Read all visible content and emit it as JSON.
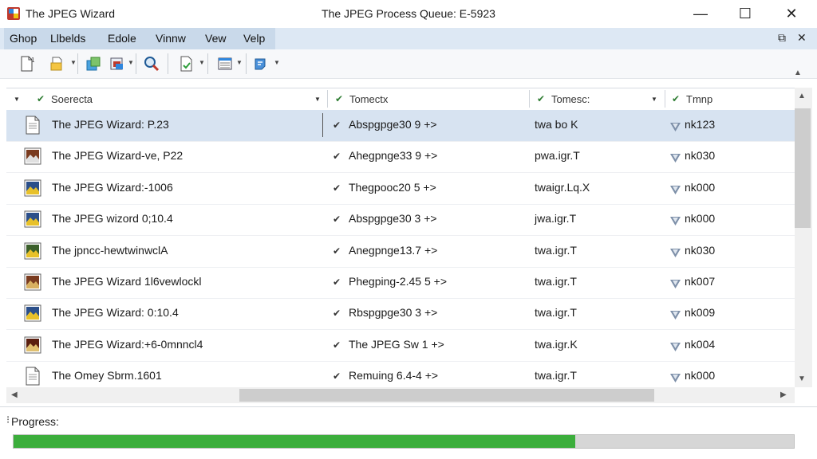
{
  "window": {
    "app_title": "The JPEG Wizard",
    "title": "The JPEG Process Queue: E-5923",
    "minimize": "—",
    "maximize": "☐",
    "close": "✕"
  },
  "menu": {
    "items": [
      "Ghop",
      "Llbelds",
      "Edole",
      "Vinnw",
      "Vew",
      "Velp"
    ],
    "mdi_restore": "⧉",
    "mdi_close": "✕"
  },
  "toolbar": {
    "icons": [
      "new-document-icon",
      "open-folder-icon",
      "package-icon",
      "batch-icon",
      "zoom-icon",
      "export-icon",
      "list-view-icon",
      "properties-icon"
    ]
  },
  "columns": [
    {
      "label": "Soerecta"
    },
    {
      "label": "Tomectx"
    },
    {
      "label": "Tomesc:"
    },
    {
      "label": "Tmnp"
    }
  ],
  "rows": [
    {
      "icon": "document-icon",
      "name": "The JPEG Wizard: P.23",
      "status": "Abspgpge30 9 +>",
      "type": "twa bo K",
      "tag": "nk123",
      "selected": true
    },
    {
      "icon": "image-icon",
      "name": "The JPEG Wizard-ve, P22",
      "status": "Ahegpnge33 9 +>",
      "type": "pwa.igr.T",
      "tag": "nk030",
      "selected": false
    },
    {
      "icon": "image-icon",
      "name": "The JPEG Wizard:-1006",
      "status": "Thegpooc20 5 +>",
      "type": "twaigr.Lq.X",
      "tag": "nk000",
      "selected": false
    },
    {
      "icon": "image-icon",
      "name": "The JPEG wizord 0;10.4",
      "status": "Abspgpge30 3 +>",
      "type": "jwa.igr.T",
      "tag": "nk000",
      "selected": false
    },
    {
      "icon": "image-icon",
      "name": "The jpncc-hewtwinwclA",
      "status": "Anegpnge13.7 +>",
      "type": "twa.igr.T",
      "tag": "nk030",
      "selected": false
    },
    {
      "icon": "image-icon",
      "name": "The JPEG Wizard 1l6vewlockl",
      "status": "Phegping-2.45 5 +>",
      "type": "twa.igr.T",
      "tag": "nk007",
      "selected": false
    },
    {
      "icon": "image-icon",
      "name": "The JPEG Wizard: 0:10.4",
      "status": "Rbspgpge30 3 +>",
      "type": "twa.igr.T",
      "tag": "nk009",
      "selected": false
    },
    {
      "icon": "image-icon",
      "name": "The JPEG Wizard:+6-0mnncl4",
      "status": "The JPEG Sw 1 +>",
      "type": "twa.igr.K",
      "tag": "nk004",
      "selected": false
    },
    {
      "icon": "document-icon",
      "name": "The Omey Sbrm.1601",
      "status": "Remuing 6.4-4 +>",
      "type": "twa.igr.T",
      "tag": "nk000",
      "selected": false
    }
  ],
  "progress": {
    "label": "Progress:",
    "fraction": 0.72,
    "fill_color": "#3cae3c"
  },
  "colors": {
    "menu_bar": "#dde8f4",
    "selection": "#d7e3f1"
  }
}
